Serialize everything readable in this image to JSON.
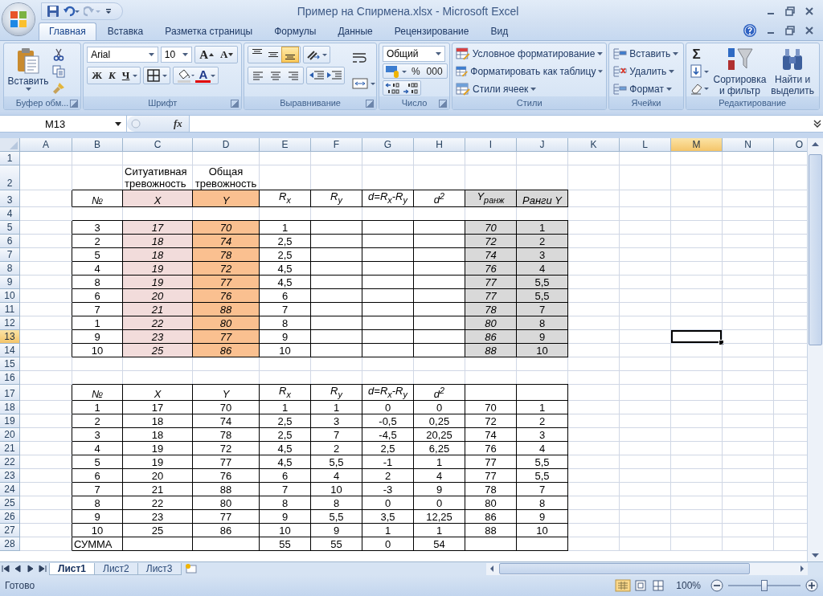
{
  "window": {
    "title": "Пример на Спирмена.xlsx - Microsoft Excel"
  },
  "tabs": [
    {
      "label": "Главная",
      "selected": true
    },
    {
      "label": "Вставка",
      "selected": false
    },
    {
      "label": "Разметка страницы",
      "selected": false
    },
    {
      "label": "Формулы",
      "selected": false
    },
    {
      "label": "Данные",
      "selected": false
    },
    {
      "label": "Рецензирование",
      "selected": false
    },
    {
      "label": "Вид",
      "selected": false
    }
  ],
  "ribbon": {
    "clipboard": {
      "paste": "Вставить",
      "title": "Буфер обм..."
    },
    "font": {
      "name": "Arial",
      "size": "10",
      "grow": "A",
      "shrink": "A",
      "bold": "Ж",
      "italic": "К",
      "underline": "Ч",
      "color_letter": "A",
      "title": "Шрифт"
    },
    "alignment": {
      "vertical": [
        {
          "kind": "top",
          "selected": false
        },
        {
          "kind": "middle",
          "selected": false
        },
        {
          "kind": "bottom",
          "selected": true
        }
      ],
      "horizontal": [
        {
          "kind": "left",
          "selected": false
        },
        {
          "kind": "center",
          "selected": false
        },
        {
          "kind": "right",
          "selected": false
        }
      ],
      "title": "Выравнивание"
    },
    "number": {
      "format": "Общий",
      "percent": "%",
      "thousands": "000",
      "title": "Число"
    },
    "styles": {
      "items": [
        "Условное форматирование",
        "Форматировать как таблицу",
        "Стили ячеек"
      ],
      "title": "Стили"
    },
    "cells": {
      "items": [
        "Вставить",
        "Удалить",
        "Формат"
      ],
      "title": "Ячейки"
    },
    "editing": {
      "sum": "Σ",
      "sort": "Сортировка и фильтр",
      "find": "Найти и выделить",
      "title": "Редактирование"
    }
  },
  "formula_bar": {
    "name_box": "M13",
    "function_label": "fx"
  },
  "columns": [
    {
      "label": "A",
      "selected": false
    },
    {
      "label": "B",
      "selected": false
    },
    {
      "label": "C",
      "selected": false
    },
    {
      "label": "D",
      "selected": false
    },
    {
      "label": "E",
      "selected": false
    },
    {
      "label": "F",
      "selected": false
    },
    {
      "label": "G",
      "selected": false
    },
    {
      "label": "H",
      "selected": false
    },
    {
      "label": "I",
      "selected": false
    },
    {
      "label": "J",
      "selected": false
    },
    {
      "label": "K",
      "selected": false
    },
    {
      "label": "L",
      "selected": false
    },
    {
      "label": "M",
      "selected": true
    },
    {
      "label": "N",
      "selected": false
    },
    {
      "label": "O",
      "selected": false
    }
  ],
  "rows": [
    {
      "number": "1",
      "selected": false,
      "bordered": false
    },
    {
      "number": "2",
      "selected": false,
      "bordered": false,
      "cells": {
        "C": {
          "text": "Ситуативная тревожность",
          "italic": false,
          "kind": "label"
        },
        "D": {
          "text": "Общая тревожность",
          "italic": false
        }
      }
    },
    {
      "number": "3",
      "selected": false,
      "bordered": true,
      "cells": {
        "B": {
          "text": "№",
          "italic": true
        },
        "C": {
          "text": "X",
          "italic": true,
          "color": "#f2dcdb"
        },
        "D": {
          "text": "Y",
          "italic": true,
          "color": "#fac090"
        },
        "E": {
          "text": "R$_{x}$",
          "italic": true
        },
        "F": {
          "text": "R$_{y}$",
          "italic": true
        },
        "G": {
          "text": "d=R$_{x}$-R$_{y}$",
          "italic": true
        },
        "H": {
          "text": "d$^{2}$",
          "italic": true
        },
        "I": {
          "text": "Y$_{ранж}$",
          "italic": true,
          "color": "#d9d9d9"
        },
        "J": {
          "text": "Ранги Y",
          "italic": true,
          "color": "#d9d9d9"
        }
      }
    },
    {
      "number": "4",
      "selected": false,
      "bordered": false
    },
    {
      "number": "5",
      "selected": false,
      "bordered": true,
      "cells": {
        "B": {
          "text": "3",
          "italic": false
        },
        "C": {
          "text": "17",
          "italic": true,
          "color": "#f2dcdb"
        },
        "D": {
          "text": "70",
          "italic": true,
          "color": "#fac090"
        },
        "E": {
          "text": "1",
          "italic": false
        },
        "I": {
          "text": "70",
          "italic": true,
          "color": "#d9d9d9"
        },
        "J": {
          "text": "1",
          "italic": false,
          "color": "#d9d9d9"
        }
      }
    },
    {
      "number": "6",
      "selected": false,
      "bordered": true,
      "cells": {
        "B": {
          "text": "2",
          "italic": false
        },
        "C": {
          "text": "18",
          "italic": true,
          "color": "#f2dcdb"
        },
        "D": {
          "text": "74",
          "italic": true,
          "color": "#fac090"
        },
        "E": {
          "text": "2,5",
          "italic": false
        },
        "I": {
          "text": "72",
          "italic": true,
          "color": "#d9d9d9"
        },
        "J": {
          "text": "2",
          "italic": false,
          "color": "#d9d9d9"
        }
      }
    },
    {
      "number": "7",
      "selected": false,
      "bordered": true,
      "cells": {
        "B": {
          "text": "5",
          "italic": false
        },
        "C": {
          "text": "18",
          "italic": true,
          "color": "#f2dcdb"
        },
        "D": {
          "text": "78",
          "italic": true,
          "color": "#fac090"
        },
        "E": {
          "text": "2,5",
          "italic": false
        },
        "I": {
          "text": "74",
          "italic": true,
          "color": "#d9d9d9"
        },
        "J": {
          "text": "3",
          "italic": false,
          "color": "#d9d9d9"
        }
      }
    },
    {
      "number": "8",
      "selected": false,
      "bordered": true,
      "cells": {
        "B": {
          "text": "4",
          "italic": false
        },
        "C": {
          "text": "19",
          "italic": true,
          "color": "#f2dcdb"
        },
        "D": {
          "text": "72",
          "italic": true,
          "color": "#fac090"
        },
        "E": {
          "text": "4,5",
          "italic": false
        },
        "I": {
          "text": "76",
          "italic": true,
          "color": "#d9d9d9"
        },
        "J": {
          "text": "4",
          "italic": false,
          "color": "#d9d9d9"
        }
      }
    },
    {
      "number": "9",
      "selected": false,
      "bordered": true,
      "cells": {
        "B": {
          "text": "8",
          "italic": false
        },
        "C": {
          "text": "19",
          "italic": true,
          "color": "#f2dcdb"
        },
        "D": {
          "text": "77",
          "italic": true,
          "color": "#fac090"
        },
        "E": {
          "text": "4,5",
          "italic": false
        },
        "I": {
          "text": "77",
          "italic": true,
          "color": "#d9d9d9"
        },
        "J": {
          "text": "5,5",
          "italic": false,
          "color": "#d9d9d9"
        }
      }
    },
    {
      "number": "10",
      "selected": false,
      "bordered": true,
      "cells": {
        "B": {
          "text": "6",
          "italic": false
        },
        "C": {
          "text": "20",
          "italic": true,
          "color": "#f2dcdb"
        },
        "D": {
          "text": "76",
          "italic": true,
          "color": "#fac090"
        },
        "E": {
          "text": "6",
          "italic": false
        },
        "I": {
          "text": "77",
          "italic": true,
          "color": "#d9d9d9"
        },
        "J": {
          "text": "5,5",
          "italic": false,
          "color": "#d9d9d9"
        }
      }
    },
    {
      "number": "11",
      "selected": false,
      "bordered": true,
      "cells": {
        "B": {
          "text": "7",
          "italic": false
        },
        "C": {
          "text": "21",
          "italic": true,
          "color": "#f2dcdb"
        },
        "D": {
          "text": "88",
          "italic": true,
          "color": "#fac090"
        },
        "E": {
          "text": "7",
          "italic": false
        },
        "I": {
          "text": "78",
          "italic": true,
          "color": "#d9d9d9"
        },
        "J": {
          "text": "7",
          "italic": false,
          "color": "#d9d9d9"
        }
      }
    },
    {
      "number": "12",
      "selected": false,
      "bordered": true,
      "cells": {
        "B": {
          "text": "1",
          "italic": false
        },
        "C": {
          "text": "22",
          "italic": true,
          "color": "#f2dcdb"
        },
        "D": {
          "text": "80",
          "italic": true,
          "color": "#fac090"
        },
        "E": {
          "text": "8",
          "italic": false
        },
        "I": {
          "text": "80",
          "italic": true,
          "color": "#d9d9d9"
        },
        "J": {
          "text": "8",
          "italic": false,
          "color": "#d9d9d9"
        }
      }
    },
    {
      "number": "13",
      "selected": true,
      "bordered": true,
      "cells": {
        "B": {
          "text": "9",
          "italic": false
        },
        "C": {
          "text": "23",
          "italic": true,
          "color": "#f2dcdb"
        },
        "D": {
          "text": "77",
          "italic": true,
          "color": "#fac090"
        },
        "E": {
          "text": "9",
          "italic": false
        },
        "I": {
          "text": "86",
          "italic": true,
          "color": "#d9d9d9"
        },
        "J": {
          "text": "9",
          "italic": false,
          "color": "#d9d9d9"
        }
      }
    },
    {
      "number": "14",
      "selected": false,
      "bordered": true,
      "cells": {
        "B": {
          "text": "10",
          "italic": false
        },
        "C": {
          "text": "25",
          "italic": true,
          "color": "#f2dcdb"
        },
        "D": {
          "text": "86",
          "italic": true,
          "color": "#fac090"
        },
        "E": {
          "text": "10",
          "italic": false
        },
        "I": {
          "text": "88",
          "italic": true,
          "color": "#d9d9d9"
        },
        "J": {
          "text": "10",
          "italic": false,
          "color": "#d9d9d9"
        }
      }
    },
    {
      "number": "15",
      "selected": false,
      "bordered": false
    },
    {
      "number": "16",
      "selected": false,
      "bordered": false
    },
    {
      "number": "17",
      "selected": false,
      "bordered": true,
      "cells": {
        "B": {
          "text": "№",
          "italic": true
        },
        "C": {
          "text": "X",
          "italic": true
        },
        "D": {
          "text": "Y",
          "italic": true
        },
        "E": {
          "text": "R$_{x}$",
          "italic": true
        },
        "F": {
          "text": "R$_{y}$",
          "italic": true
        },
        "G": {
          "text": "d=R$_{x}$-R$_{y}$",
          "italic": true
        },
        "H": {
          "text": "d$^{2}$",
          "italic": true
        }
      }
    },
    {
      "number": "18",
      "selected": false,
      "bordered": true,
      "cells": {
        "B": {
          "text": "1",
          "italic": false
        },
        "C": {
          "text": "17",
          "italic": false
        },
        "D": {
          "text": "70",
          "italic": false
        },
        "E": {
          "text": "1",
          "italic": false
        },
        "F": {
          "text": "1",
          "italic": false
        },
        "G": {
          "text": "0",
          "italic": false
        },
        "H": {
          "text": "0",
          "italic": false
        },
        "I": {
          "text": "70",
          "italic": false
        },
        "J": {
          "text": "1",
          "italic": false
        }
      }
    },
    {
      "number": "19",
      "selected": false,
      "bordered": true,
      "cells": {
        "B": {
          "text": "2",
          "italic": false
        },
        "C": {
          "text": "18",
          "italic": false
        },
        "D": {
          "text": "74",
          "italic": false
        },
        "E": {
          "text": "2,5",
          "italic": false
        },
        "F": {
          "text": "3",
          "italic": false
        },
        "G": {
          "text": "-0,5",
          "italic": false
        },
        "H": {
          "text": "0,25",
          "italic": false
        },
        "I": {
          "text": "72",
          "italic": false
        },
        "J": {
          "text": "2",
          "italic": false
        }
      }
    },
    {
      "number": "20",
      "selected": false,
      "bordered": true,
      "cells": {
        "B": {
          "text": "3",
          "italic": false
        },
        "C": {
          "text": "18",
          "italic": false
        },
        "D": {
          "text": "78",
          "italic": false
        },
        "E": {
          "text": "2,5",
          "italic": false
        },
        "F": {
          "text": "7",
          "italic": false
        },
        "G": {
          "text": "-4,5",
          "italic": false
        },
        "H": {
          "text": "20,25",
          "italic": false
        },
        "I": {
          "text": "74",
          "italic": false
        },
        "J": {
          "text": "3",
          "italic": false
        }
      }
    },
    {
      "number": "21",
      "selected": false,
      "bordered": true,
      "cells": {
        "B": {
          "text": "4",
          "italic": false
        },
        "C": {
          "text": "19",
          "italic": false
        },
        "D": {
          "text": "72",
          "italic": false
        },
        "E": {
          "text": "4,5",
          "italic": false
        },
        "F": {
          "text": "2",
          "italic": false
        },
        "G": {
          "text": "2,5",
          "italic": false
        },
        "H": {
          "text": "6,25",
          "italic": false
        },
        "I": {
          "text": "76",
          "italic": false
        },
        "J": {
          "text": "4",
          "italic": false
        }
      }
    },
    {
      "number": "22",
      "selected": false,
      "bordered": true,
      "cells": {
        "B": {
          "text": "5",
          "italic": false
        },
        "C": {
          "text": "19",
          "italic": false
        },
        "D": {
          "text": "77",
          "italic": false
        },
        "E": {
          "text": "4,5",
          "italic": false
        },
        "F": {
          "text": "5,5",
          "italic": false
        },
        "G": {
          "text": "-1",
          "italic": false
        },
        "H": {
          "text": "1",
          "italic": false
        },
        "I": {
          "text": "77",
          "italic": false
        },
        "J": {
          "text": "5,5",
          "italic": false
        }
      }
    },
    {
      "number": "23",
      "selected": false,
      "bordered": true,
      "cells": {
        "B": {
          "text": "6",
          "italic": false
        },
        "C": {
          "text": "20",
          "italic": false
        },
        "D": {
          "text": "76",
          "italic": false
        },
        "E": {
          "text": "6",
          "italic": false
        },
        "F": {
          "text": "4",
          "italic": false
        },
        "G": {
          "text": "2",
          "italic": false
        },
        "H": {
          "text": "4",
          "italic": false
        },
        "I": {
          "text": "77",
          "italic": false
        },
        "J": {
          "text": "5,5",
          "italic": false
        }
      }
    },
    {
      "number": "24",
      "selected": false,
      "bordered": true,
      "cells": {
        "B": {
          "text": "7",
          "italic": false
        },
        "C": {
          "text": "21",
          "italic": false
        },
        "D": {
          "text": "88",
          "italic": false
        },
        "E": {
          "text": "7",
          "italic": false
        },
        "F": {
          "text": "10",
          "italic": false
        },
        "G": {
          "text": "-3",
          "italic": false
        },
        "H": {
          "text": "9",
          "italic": false
        },
        "I": {
          "text": "78",
          "italic": false
        },
        "J": {
          "text": "7",
          "italic": false
        }
      }
    },
    {
      "number": "25",
      "selected": false,
      "bordered": true,
      "cells": {
        "B": {
          "text": "8",
          "italic": false
        },
        "C": {
          "text": "22",
          "italic": false
        },
        "D": {
          "text": "80",
          "italic": false
        },
        "E": {
          "text": "8",
          "italic": false
        },
        "F": {
          "text": "8",
          "italic": false
        },
        "G": {
          "text": "0",
          "italic": false
        },
        "H": {
          "text": "0",
          "italic": false
        },
        "I": {
          "text": "80",
          "italic": false
        },
        "J": {
          "text": "8",
          "italic": false
        }
      }
    },
    {
      "number": "26",
      "selected": false,
      "bordered": true,
      "cells": {
        "B": {
          "text": "9",
          "italic": false
        },
        "C": {
          "text": "23",
          "italic": false
        },
        "D": {
          "text": "77",
          "italic": false
        },
        "E": {
          "text": "9",
          "italic": false
        },
        "F": {
          "text": "5,5",
          "italic": false
        },
        "G": {
          "text": "3,5",
          "italic": false
        },
        "H": {
          "text": "12,25",
          "italic": false
        },
        "I": {
          "text": "86",
          "italic": false
        },
        "J": {
          "text": "9",
          "italic": false
        }
      }
    },
    {
      "number": "27",
      "selected": false,
      "bordered": true,
      "cells": {
        "B": {
          "text": "10",
          "italic": false
        },
        "C": {
          "text": "25",
          "italic": false
        },
        "D": {
          "text": "86",
          "italic": false
        },
        "E": {
          "text": "10",
          "italic": false
        },
        "F": {
          "text": "9",
          "italic": false
        },
        "G": {
          "text": "1",
          "italic": false
        },
        "H": {
          "text": "1",
          "italic": false
        },
        "I": {
          "text": "88",
          "italic": false
        },
        "J": {
          "text": "10",
          "italic": false
        }
      }
    },
    {
      "number": "28",
      "selected": false,
      "bordered": true,
      "cells": {
        "B": {
          "text": "СУММА",
          "italic": false,
          "kind": "label"
        },
        "E": {
          "text": "55",
          "italic": false
        },
        "F": {
          "text": "55",
          "italic": false
        },
        "G": {
          "text": "0",
          "italic": false
        },
        "H": {
          "text": "54",
          "italic": false
        }
      }
    }
  ],
  "sheets": [
    {
      "label": "Лист1",
      "selected": true
    },
    {
      "label": "Лист2",
      "selected": false
    },
    {
      "label": "Лист3",
      "selected": false
    }
  ],
  "status_bar": {
    "text": "Готово",
    "zoom": "100%",
    "zoom_slider": {
      "level": 0.5
    }
  }
}
